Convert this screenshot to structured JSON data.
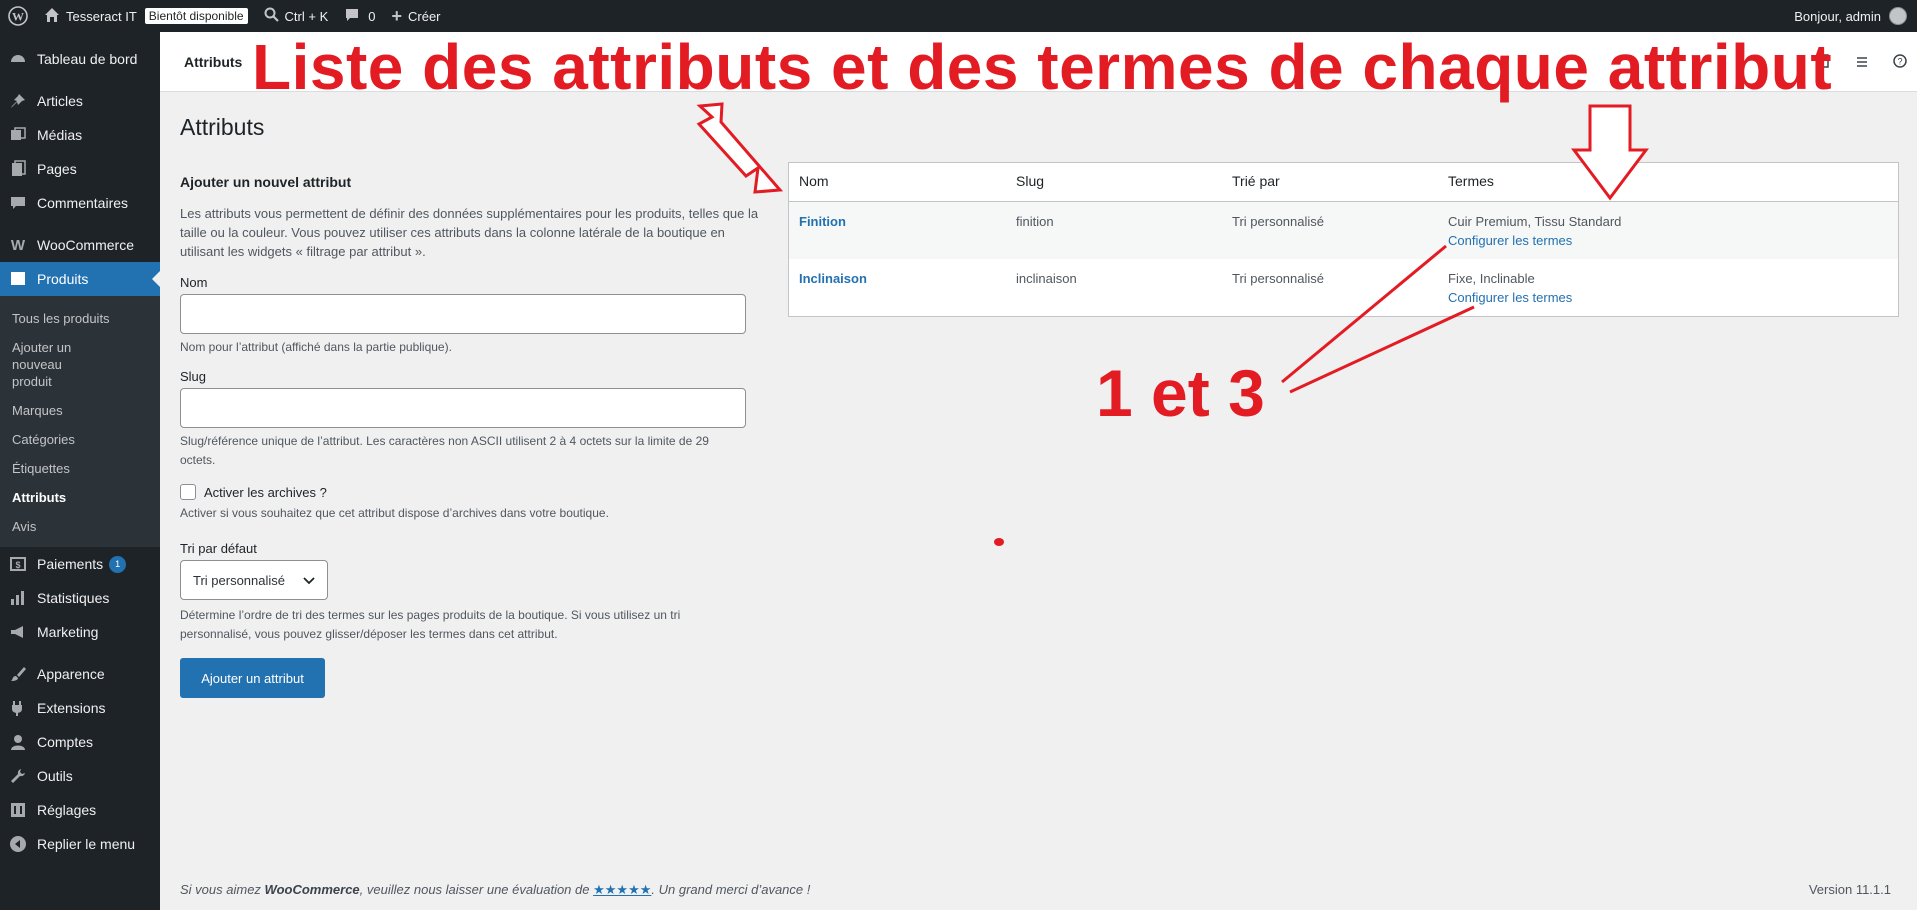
{
  "adminbar": {
    "site_name": "Tesseract IT",
    "badge": "Bientôt disponible",
    "shortcut": "Ctrl + K",
    "comments_count": "0",
    "create_label": "Créer",
    "greeting": "Bonjour, admin"
  },
  "sidebar": {
    "items": [
      {
        "label": "Tableau de bord",
        "icon": "dashboard-icon"
      },
      {
        "label": "Articles",
        "icon": "pin-icon"
      },
      {
        "label": "Médias",
        "icon": "media-icon"
      },
      {
        "label": "Pages",
        "icon": "pages-icon"
      },
      {
        "label": "Commentaires",
        "icon": "comment-icon"
      },
      {
        "label": "WooCommerce",
        "icon": "woocommerce-icon"
      },
      {
        "label": "Produits",
        "icon": "products-icon"
      },
      {
        "label": "Paiements",
        "icon": "payments-icon",
        "badge": "1"
      },
      {
        "label": "Statistiques",
        "icon": "stats-icon"
      },
      {
        "label": "Marketing",
        "icon": "megaphone-icon"
      },
      {
        "label": "Apparence",
        "icon": "brush-icon"
      },
      {
        "label": "Extensions",
        "icon": "plugin-icon"
      },
      {
        "label": "Comptes",
        "icon": "user-icon"
      },
      {
        "label": "Outils",
        "icon": "wrench-icon"
      },
      {
        "label": "Réglages",
        "icon": "settings-icon"
      },
      {
        "label": "Replier le menu",
        "icon": "collapse-icon"
      }
    ],
    "submenu": [
      "Tous les produits",
      "Ajouter un nouveau produit",
      "Marques",
      "Catégories",
      "Étiquettes",
      "Attributs",
      "Avis"
    ]
  },
  "header": {
    "title": "Attributs"
  },
  "page": {
    "title": "Attributs"
  },
  "form": {
    "heading": "Ajouter un nouvel attribut",
    "intro": "Les attributs vous permettent de définir des données supplémentaires pour les produits, telles que la taille ou la couleur. Vous pouvez utiliser ces attributs dans la colonne latérale de la boutique en utilisant les widgets « filtrage par attribut ».",
    "name_label": "Nom",
    "name_desc": "Nom pour l’attribut (affiché dans la partie publique).",
    "slug_label": "Slug",
    "slug_desc": "Slug/référence unique de l’attribut. Les caractères non ASCII utilisent 2 à 4 octets sur la limite de 29 octets.",
    "archives_label": "Activer les archives ?",
    "archives_desc": "Activer si vous souhaitez que cet attribut dispose d’archives dans votre boutique.",
    "sort_label": "Tri par défaut",
    "sort_value": "Tri personnalisé",
    "sort_desc": "Détermine l’ordre de tri des termes sur les pages produits de la boutique. Si vous utilisez un tri personnalisé, vous pouvez glisser/déposer les termes dans cet attribut.",
    "submit": "Ajouter un attribut"
  },
  "table": {
    "headers": [
      "Nom",
      "Slug",
      "Trié par",
      "Termes"
    ],
    "rows": [
      {
        "name": "Finition",
        "slug": "finition",
        "sort": "Tri personnalisé",
        "terms": "Cuir Premium, Tissu Standard",
        "configure": "Configurer les termes"
      },
      {
        "name": "Inclinaison",
        "slug": "inclinaison",
        "sort": "Tri personnalisé",
        "terms": "Fixe, Inclinable",
        "configure": "Configurer les termes"
      }
    ]
  },
  "footer": {
    "before": "Si vous aimez ",
    "brand": "WooCommerce",
    "middle": ", veuillez nous laisser une évaluation de ",
    "stars": "★★★★★",
    "after": ". Un grand merci d’avance !",
    "version": "Version 11.1.1"
  },
  "annotations": {
    "title": "Liste des attributs et des termes de chaque attribut",
    "numbers": "1 et 3",
    "color": "#e31b23"
  }
}
